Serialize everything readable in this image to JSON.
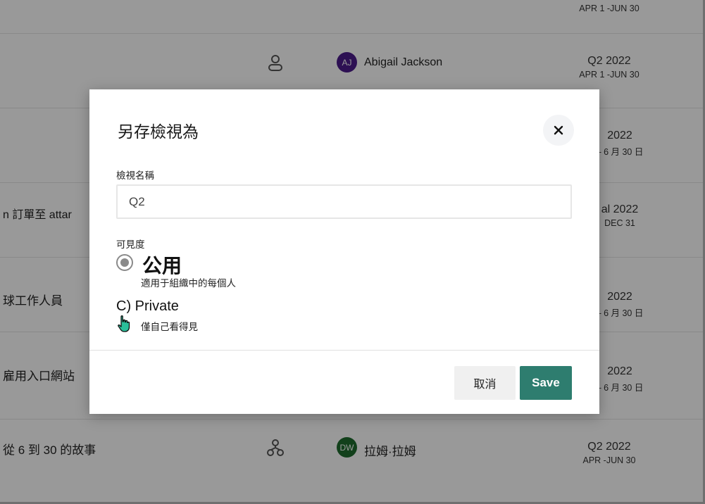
{
  "background_list": {
    "rows": [
      {
        "title": "",
        "owner": "",
        "avatar_initials": "",
        "quarter": "",
        "range": "APR 1 -JUN 30"
      },
      {
        "title": "",
        "owner": "Abigail Jackson",
        "avatar_initials": "AJ",
        "avatar_color": "#4b1c8a",
        "owner_icon": "person-icon",
        "quarter": "Q2 2022",
        "range": "APR 1 -JUN 30"
      },
      {
        "title": "",
        "quarter": "2022",
        "range": "– 6 月 30 日"
      },
      {
        "title": "n 訂單至 attar",
        "quarter": "al 2022",
        "range": "DEC 31"
      },
      {
        "title": "球工作人員",
        "quarter": "2022",
        "range": "– 6 月 30 日"
      },
      {
        "title": "雇用入口網站",
        "quarter": "2022",
        "range": "– 6 月 30 日"
      },
      {
        "title": "從 6 到 30 的故事",
        "owner": "拉姆·拉姆",
        "avatar_initials": "DW",
        "avatar_color": "#1e6b2e",
        "owner_icon": "org-chart-icon",
        "quarter": "Q2 2022",
        "range": "APR -JUN 30"
      }
    ]
  },
  "dialog": {
    "title": "另存檢視為",
    "close_icon": "close-icon",
    "name_label": "檢視名稱",
    "name_value": "Q2",
    "visibility_label": "可見度",
    "options": {
      "public": {
        "label": "公用",
        "description": "適用于組織中的每個人",
        "selected": true
      },
      "private": {
        "label": "C) Private",
        "description": "僅自己看得見",
        "selected": false,
        "cursor_icon": "hand-pointer-icon"
      }
    },
    "cancel_label": "取消",
    "save_label": "Save"
  },
  "colors": {
    "save_button": "#2e7d6f",
    "overlay": "rgba(0,0,0,0.40)",
    "avatar_aj": "#4b1c8a",
    "avatar_dw": "#1e6b2e",
    "cursor_hand": "#2bbf9a"
  }
}
